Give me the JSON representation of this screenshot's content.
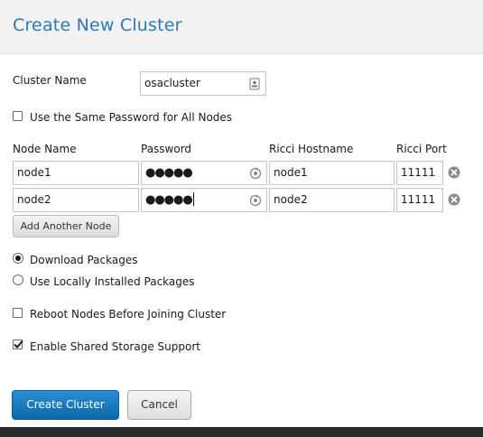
{
  "header": {
    "title": "Create New Cluster"
  },
  "form": {
    "cluster_name_label": "Cluster Name",
    "cluster_name_value": "osacluster",
    "same_password_label": "Use the Same Password for All Nodes",
    "columns": {
      "node_name": "Node Name",
      "password": "Password",
      "ricci_hostname": "Ricci Hostname",
      "ricci_port": "Ricci Port"
    },
    "nodes": [
      {
        "name": "node1",
        "password_mask": "●●●●●",
        "hostname": "node1",
        "port": "11111"
      },
      {
        "name": "node2",
        "password_mask": "●●●●●",
        "hostname": "node2",
        "port": "11111"
      }
    ],
    "add_node_label": "Add Another Node",
    "download_packages_label": "Download Packages",
    "local_packages_label": "Use Locally Installed Packages",
    "selected_package_option": "Download Packages",
    "reboot_label": "Reboot Nodes Before Joining Cluster",
    "reboot_checked": false,
    "shared_storage_label": "Enable Shared Storage Support",
    "shared_storage_checked": true,
    "same_password_checked": false
  },
  "actions": {
    "create_label": "Create Cluster",
    "cancel_label": "Cancel"
  },
  "colors": {
    "title": "#2b7ab8",
    "primary_button": "#1a7bc0",
    "header_bg": "#f2f2f2"
  }
}
